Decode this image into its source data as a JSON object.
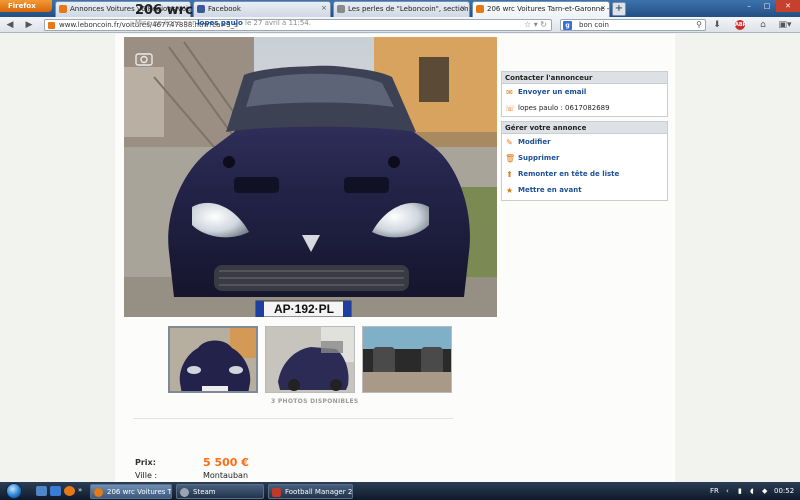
{
  "browser": {
    "menu_button": "Firefox",
    "tabs": [
      {
        "label": "Annonces Voitures v6 Régions voisin...",
        "icon_color": "#e67817",
        "active": false
      },
      {
        "label": "Facebook",
        "icon_color": "#3b5998",
        "active": false
      },
      {
        "label": "Les perles de \"Leboncoin\", section Au...",
        "icon_color": "#8a8a8a",
        "active": false
      },
      {
        "label": "206 wrc Voitures Tarn-et-Garonne - le...",
        "icon_color": "#e67817",
        "active": true
      }
    ],
    "new_tab": "+",
    "close_glyph": "×",
    "url": "www.leboncoin.fr/voitures/467747888.htm?ca=3_s",
    "search_engine": "g",
    "search_text": "bon coin",
    "window_controls": {
      "minimize": "–",
      "maximize": "□",
      "close": "✕"
    }
  },
  "ad": {
    "title": "206 wrc",
    "meta_prefix": "Mise en ligne par",
    "author": "lopes paulo",
    "meta_suffix": "le 27 avril à 11:54.",
    "photos_available": "3 PHOTOS DISPONIBLES",
    "plate": "AP·192·PL",
    "details": {
      "price_label": "Prix:",
      "price_value": "5 500 €",
      "city_label": "Ville :",
      "city_value": "Montauban"
    }
  },
  "contact_box": {
    "title": "Contacter l'annonceur",
    "email_label": "Envoyer un email",
    "phone_label": "lopes paulo : 0617082689"
  },
  "manage_box": {
    "title": "Gérer votre annonce",
    "modify": "Modifier",
    "delete": "Supprimer",
    "bump": "Remonter en tête de liste",
    "feature": "Mettre en avant"
  },
  "taskbar": {
    "tasks": [
      {
        "label": "206 wrc Voitures Tar...",
        "icon_color": "#e67817",
        "active": true
      },
      {
        "label": "Steam",
        "icon_color": "#9aa4b0",
        "active": false
      },
      {
        "label": "Football Manager 2...",
        "icon_color": "#c0392b",
        "active": false
      }
    ],
    "language": "FR",
    "clock": "00:52"
  },
  "colors": {
    "link": "#1b4f95",
    "price": "#ff6e14",
    "accent_icon": "#e07a16"
  }
}
